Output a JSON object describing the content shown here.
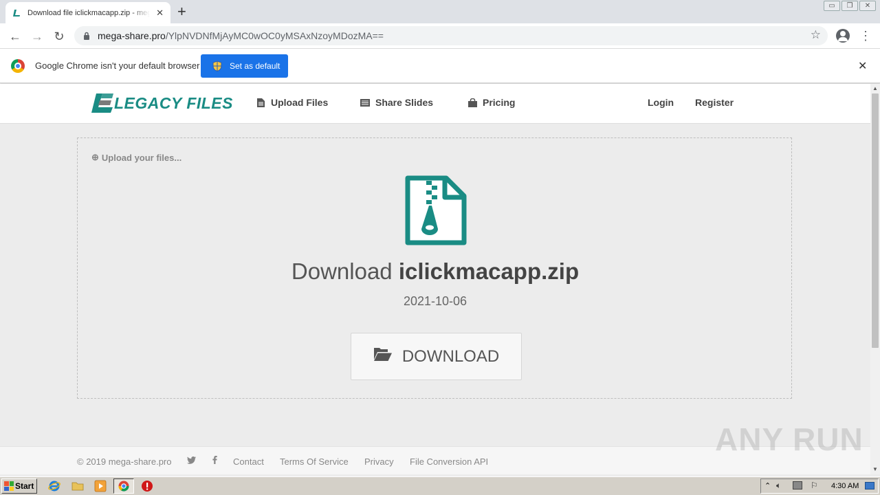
{
  "browser": {
    "tab_title": "Download file iclickmacapp.zip - mega-share.pro",
    "url_host": "mega-share.pro",
    "url_path": "/YlpNVDNfMjAyMC0wOC0yMSAxNzoyMDozMA=="
  },
  "infobar": {
    "message": "Google Chrome isn't your default browser",
    "button_label": "Set as default"
  },
  "site": {
    "logo_text": "LEGACY FILES",
    "nav": {
      "upload": "Upload Files",
      "slides": "Share Slides",
      "pricing": "Pricing",
      "login": "Login",
      "register": "Register"
    },
    "accent_color": "#1a8c84"
  },
  "download": {
    "upload_hint": "Upload your files...",
    "title_prefix": "Download",
    "filename": "iclickmacapp.zip",
    "date": "2021-10-06",
    "button_label": "DOWNLOAD"
  },
  "footer": {
    "copyright": "© 2019 mega-share.pro",
    "twitter_icon": "twitter-icon",
    "facebook_icon": "facebook-icon",
    "links": [
      "Contact",
      "Terms Of Service",
      "Privacy",
      "File Conversion API"
    ]
  },
  "watermark": "ANY RUN",
  "taskbar": {
    "start_label": "Start",
    "clock": "4:30 AM"
  }
}
